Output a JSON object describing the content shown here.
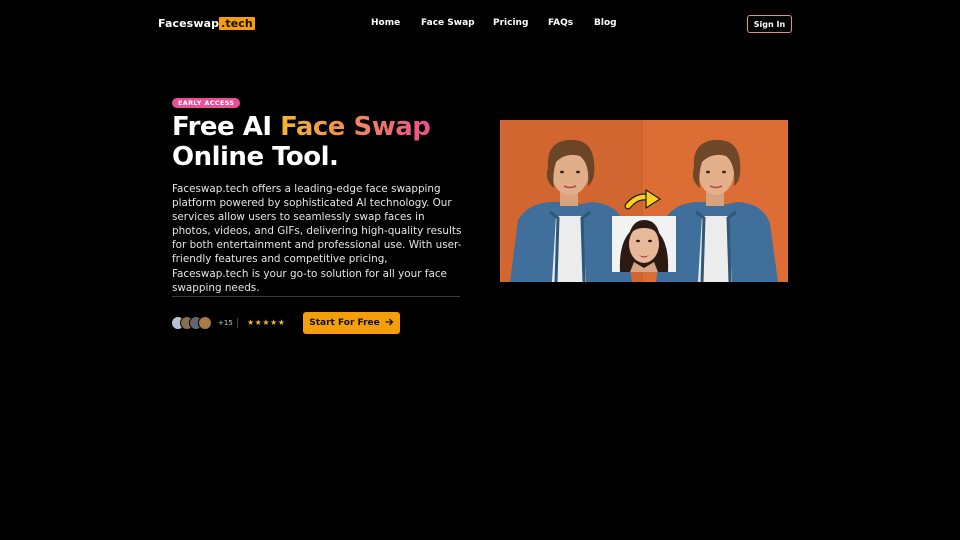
{
  "nav": {
    "logo_main": "Faceswap",
    "logo_tld": ".tech",
    "links": [
      "Home",
      "Face Swap",
      "Pricing",
      "FAQs",
      "Blog"
    ],
    "signin_label": "Sign In"
  },
  "hero": {
    "badge": "EARLY ACCESS",
    "headline_part1": "Free AI ",
    "headline_highlight": "Face Swap",
    "headline_part2": "Online Tool.",
    "description": "Faceswap.tech offers a leading-edge face swapping platform powered by sophisticated AI technology. Our services allow users to seamlessly swap faces in photos, videos, and GIFs, delivering high-quality results for both entertainment and professional use. With user-friendly features and competitive pricing, Faceswap.tech is your go-to solution for all your face swapping needs.",
    "user_count": "+15",
    "stars": "★★★★★",
    "cta_label": "Start For Free",
    "cta_icon": "arrow-right-icon"
  },
  "colors": {
    "accent": "#f59e0b",
    "badge": "#ec4f9a",
    "image_bg": "#d96a32"
  }
}
